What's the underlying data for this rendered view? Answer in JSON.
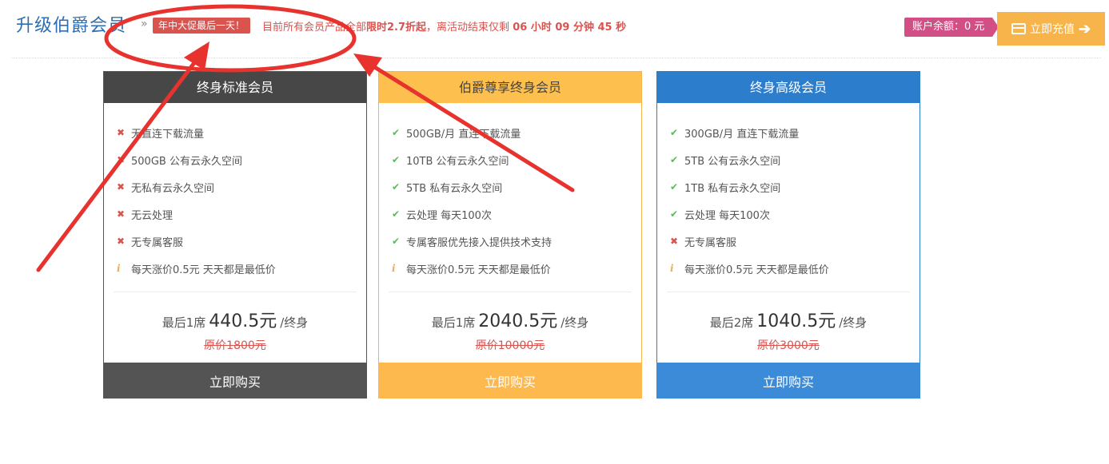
{
  "header": {
    "title": "升级伯爵会员",
    "separator": "»",
    "promo_badge": "年中大促最后一天！",
    "promo_prefix": "目前所有会员产品全部",
    "promo_discount": "限时2.7折起",
    "promo_middle": "，离活动结束仅剩",
    "countdown": "06 小时 09 分钟 45 秒",
    "balance": "账户余额：0 元",
    "recharge_label": "立即充值"
  },
  "plans": [
    {
      "title": "终身标准会员",
      "features": [
        {
          "status": "no",
          "text": "无直连下载流量"
        },
        {
          "status": "no",
          "text": "500GB 公有云永久空间"
        },
        {
          "status": "no",
          "text": "无私有云永久空间"
        },
        {
          "status": "no",
          "text": "无云处理"
        },
        {
          "status": "no",
          "text": "无专属客服"
        },
        {
          "status": "info",
          "text": "每天涨价0.5元 天天都是最低价"
        }
      ],
      "seats": "最后1席",
      "price": "440.5元",
      "unit": "/终身",
      "original": "原价1800元",
      "buy_label": "立即购买"
    },
    {
      "title": "伯爵尊享终身会员",
      "features": [
        {
          "status": "ok",
          "text": "500GB/月 直连下载流量"
        },
        {
          "status": "ok",
          "text": "10TB 公有云永久空间"
        },
        {
          "status": "ok",
          "text": "5TB 私有云永久空间"
        },
        {
          "status": "ok",
          "text": "云处理 每天100次"
        },
        {
          "status": "ok",
          "text": "专属客服优先接入提供技术支持"
        },
        {
          "status": "info",
          "text": "每天涨价0.5元 天天都是最低价"
        }
      ],
      "seats": "最后1席",
      "price": "2040.5元",
      "unit": "/终身",
      "original": "原价10000元",
      "buy_label": "立即购买"
    },
    {
      "title": "终身高级会员",
      "features": [
        {
          "status": "ok",
          "text": "300GB/月 直连下载流量"
        },
        {
          "status": "ok",
          "text": "5TB 公有云永久空间"
        },
        {
          "status": "ok",
          "text": "1TB 私有云永久空间"
        },
        {
          "status": "ok",
          "text": "云处理 每天100次"
        },
        {
          "status": "no",
          "text": "无专属客服"
        },
        {
          "status": "info",
          "text": "每天涨价0.5元 天天都是最低价"
        }
      ],
      "seats": "最后2席",
      "price": "1040.5元",
      "unit": "/终身",
      "original": "原价3000元",
      "buy_label": "立即购买"
    }
  ],
  "icons": {
    "ok": "check-icon",
    "no": "cross-icon",
    "info": "info-icon"
  },
  "colors": {
    "annotation": "#e8322e",
    "accent": "#f7b44a",
    "title": "#2f6fb0"
  }
}
